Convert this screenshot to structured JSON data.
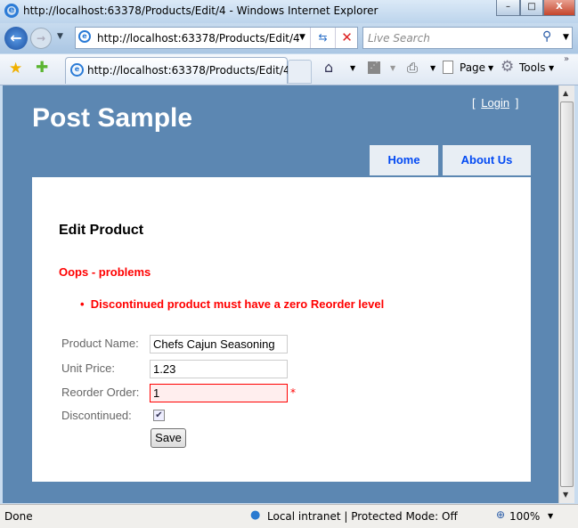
{
  "window": {
    "title": "http://localhost:63378/Products/Edit/4 - Windows Internet Explorer",
    "minimize": "–",
    "maximize": "□",
    "close": "X"
  },
  "nav": {
    "address": "http://localhost:63378/Products/Edit/4",
    "search_placeholder": "Live Search"
  },
  "tabs": [
    {
      "label": "http://localhost:63378/Products/Edit/4"
    }
  ],
  "commandbar": {
    "page": "Page",
    "tools": "Tools"
  },
  "site": {
    "title": "Post Sample",
    "login_open": "[",
    "login": "Login",
    "login_close": "]",
    "menu": [
      "Home",
      "About Us"
    ]
  },
  "form": {
    "heading": "Edit Product",
    "error_title": "Oops - problems",
    "errors": [
      "Discontinued product must have a zero Reorder level"
    ],
    "fields": [
      {
        "label": "Product Name:",
        "value": "Chefs Cajun Seasoning"
      },
      {
        "label": "Unit Price:",
        "value": "1.23"
      },
      {
        "label": "Reorder Order:",
        "value": "1",
        "error_marker": "*"
      },
      {
        "label": "Discontinued:",
        "checked": true
      }
    ],
    "save": "Save"
  },
  "status": {
    "text": "Done",
    "zone": "Local intranet | Protected Mode: Off",
    "zoom": "100%"
  },
  "colors": {
    "page_bg": "#5c87b2",
    "menu_bg": "#e8eef4",
    "menu_text": "#034af3",
    "error": "#ff0000",
    "error_input_bg": "#ffeeee"
  }
}
